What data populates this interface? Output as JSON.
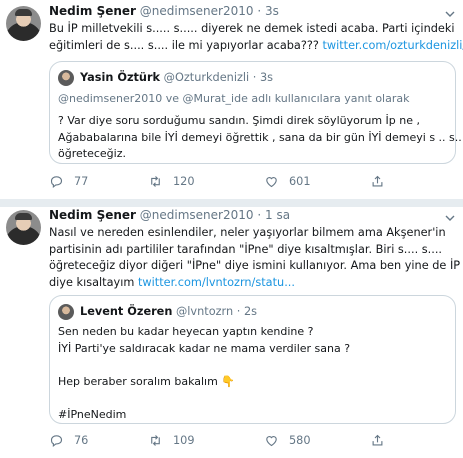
{
  "tweet1": {
    "name": "Nedim Şener",
    "handle": "@nedimsener2010",
    "dot": "·",
    "time": "3s",
    "text_lines": [
      "Bu İP milletvekili s..... s..... diyerek ne demek istedi acaba. Parti içindeki",
      "eğitimleri de s.... s.... ile mi yapıyorlar acaba???"
    ],
    "link": "twitter.com/ozturkdenizli/...",
    "quote": {
      "name": "Yasin Öztürk",
      "handle": "@Ozturkdenizli",
      "dot": "·",
      "time": "3s",
      "reply_prefix": "@nedimsener2010 ve @Murat_ide adlı kullanıcılara yanıt olarak",
      "lines": [
        "? Var diye soru sorduğumu sandın. Şimdi direk söylüyorum İp ne ,",
        "Ağababalarına bile İYİ demeyi öğrettik , sana da bir gün İYİ demeyi s .. s..",
        "öğreteceğiz."
      ]
    },
    "replies": "77",
    "retweets": "120",
    "likes": "601"
  },
  "tweet2": {
    "name": "Nedim Şener",
    "handle": "@nedimsener2010",
    "dot": "·",
    "time": "1 sa",
    "text_lines": [
      "Nasıl ve nereden esinlendiler, neler yaşıyorlar bilmem ama Akşener'in",
      "partisinin adı partililer tarafından \"İPne\" diye kısaltmışlar. Biri s.... s....",
      "öğreteceğiz diyor diğeri \"İPne\" diye ismini kullanıyor. Ama ben yine de İP",
      "diye kısaltayım"
    ],
    "link": "twitter.com/lvntozrn/statu...",
    "quote": {
      "name": "Levent Özeren",
      "handle": "@lvntozrn",
      "dot": "·",
      "time": "2s",
      "lines": [
        "Sen neden bu kadar heyecan yaptın kendine ?",
        "İYİ Parti'ye saldıracak kadar ne mama verdiler sana ?",
        "",
        "Hep beraber soralım bakalım 👇",
        "",
        "#İPneNedim"
      ]
    },
    "replies": "76",
    "retweets": "109",
    "likes": "580"
  },
  "colors": {
    "link": "#1b95e0",
    "meta": "#657786",
    "border": "#ccd6dd",
    "separator": "#e6ecf0"
  },
  "icons": [
    "reply-icon",
    "retweet-icon",
    "like-icon",
    "share-icon",
    "chevron-down-icon"
  ]
}
